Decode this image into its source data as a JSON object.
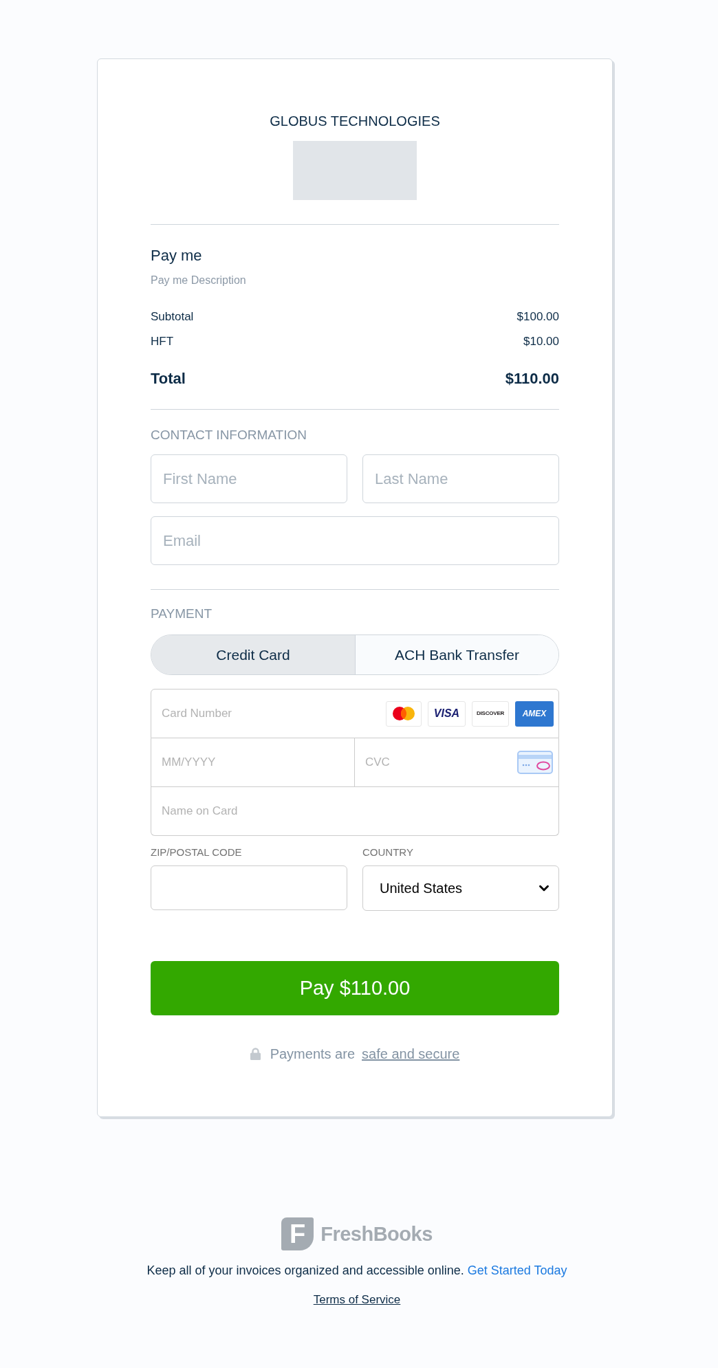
{
  "merchant": {
    "name": "GLOBUS TECHNOLOGIES"
  },
  "invoice": {
    "title": "Pay me",
    "description": "Pay me Description",
    "lines": [
      {
        "label": "Subtotal",
        "amount": "$100.00"
      },
      {
        "label": "HFT",
        "amount": "$10.00"
      }
    ],
    "total": {
      "label": "Total",
      "amount": "$110.00"
    }
  },
  "contact": {
    "heading": "CONTACT INFORMATION",
    "fields": [
      {
        "placeholder": "First Name"
      },
      {
        "placeholder": "Last Name"
      },
      {
        "placeholder": "Email"
      }
    ]
  },
  "payment": {
    "heading": "PAYMENT",
    "tabs": [
      {
        "label": "Credit Card",
        "selected": true
      },
      {
        "label": "ACH Bank Transfer",
        "selected": false
      }
    ],
    "card_number": {
      "placeholder": "Card Number"
    },
    "card_brands": [
      {
        "kind": "circles"
      },
      {
        "kind": "italic",
        "label": "VISA"
      },
      {
        "kind": "small",
        "label": "DISCOVER"
      },
      {
        "kind": "filled",
        "label": "AMEX"
      }
    ],
    "expiry": {
      "placeholder": "MM/YYYY"
    },
    "cvc": {
      "placeholder": "CVC"
    },
    "name_on_card": {
      "placeholder": "Name on Card"
    },
    "zip": {
      "label": "ZIP/POSTAL CODE"
    },
    "country": {
      "label": "COUNTRY",
      "value": "United States"
    }
  },
  "pay_button": {
    "label": "Pay $110.00"
  },
  "security_note": {
    "text": "Payments are",
    "link": "safe and secure"
  },
  "footer": {
    "logo": {
      "mark": "F",
      "wordmark": "FreshBooks"
    },
    "tagline": {
      "text": "Keep all of your invoices organized and accessible online.",
      "link": "Get Started Today"
    },
    "terms": "Terms of Service"
  }
}
